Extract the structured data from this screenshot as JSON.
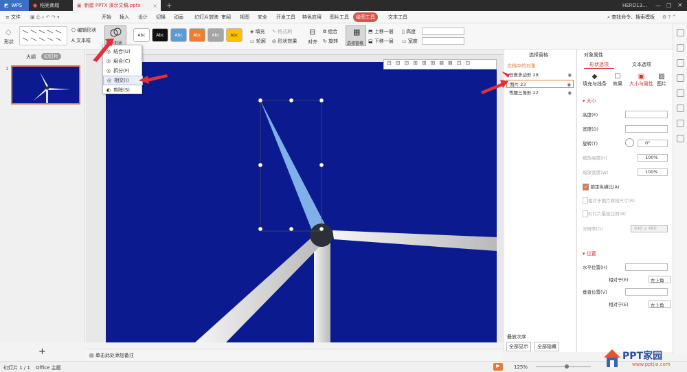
{
  "titlebar": {
    "wps": "WPS",
    "tab1": "稻壳商城",
    "tab2": "新建 PPTX 演示文稿.pptx",
    "user": "HERO13..."
  },
  "menu": {
    "file": "文件",
    "items": [
      "开始",
      "插入",
      "设计",
      "切换",
      "动画",
      "幻灯片放映",
      "审阅",
      "视图",
      "安全",
      "开发工具",
      "特色应用",
      "图片工具",
      "绘图工具",
      "文本工具"
    ],
    "active": "绘图工具",
    "search": "查找命令、搜索模板"
  },
  "ribbon": {
    "shape": "形状",
    "edit_shape": "编辑形状",
    "textbox": "文本框",
    "merge_shape": "合并形状",
    "styles": [
      "Abc",
      "Abc",
      "Abc",
      "Abc",
      "Abc",
      "Abc"
    ],
    "style_colors": [
      "#ffffff",
      "#111111",
      "#5b9bd5",
      "#ed7d31",
      "#a5a5a5",
      "#ffc000"
    ],
    "fill": "填充",
    "outline": "轮廓",
    "shape_effect": "形状效果",
    "format_brush": "格式刷",
    "align": "对齐",
    "rotate": "旋转",
    "group": "组合",
    "selection_pane": "选择窗格",
    "bring_forward": "上移一层",
    "send_backward": "下移一层",
    "height": "高度",
    "width": "宽度"
  },
  "dropdown": {
    "items": [
      "结合(U)",
      "组合(C)",
      "拆分(F)",
      "相交(I)",
      "剪除(S)"
    ],
    "selected": "相交(I)"
  },
  "leftpanel": {
    "outline_tab": "大纲",
    "slides_tab": "幻灯片",
    "slide_number": "1",
    "add": "+"
  },
  "selpane": {
    "title": "选择窗格",
    "section": "文档中的对象",
    "objects": [
      "任意多边形 28",
      "图片 23",
      "等腰三角形 22"
    ],
    "order": "叠放次序",
    "show_all": "全部显示",
    "hide_all": "全部隐藏"
  },
  "propane": {
    "title": "对象属性",
    "tab_shape": "形状选项",
    "tab_text": "文本选项",
    "subtabs": [
      "填充与线条",
      "效果",
      "大小与属性",
      "图片"
    ],
    "size_section": "大小",
    "height": "高度(E)",
    "width": "宽度(D)",
    "rotate": "旋转(T)",
    "rotate_value": "0°",
    "scale_h": "缩放高度(H)",
    "scale_w": "缩放宽度(W)",
    "scale_value": "100%",
    "lock_ratio": "锁定纵横比(A)",
    "rel_original": "相对于图片原始尺寸(R)",
    "best_scale": "幻灯片最佳比例(B)",
    "resolution": "分辨率(O)",
    "resolution_value": "640 x 480",
    "position_section": "位置",
    "hpos": "水平位置(H)",
    "vpos": "垂直位置(V)",
    "relative": "相对于(E)",
    "relative_value": "左上角"
  },
  "notes": {
    "placeholder": "单击此处添加备注"
  },
  "status": {
    "slide": "幻灯片 1 / 1",
    "theme": "Office 主题",
    "zoom": "125%",
    "site": "PPT家园",
    "site_url": "www.pptjia.com"
  }
}
